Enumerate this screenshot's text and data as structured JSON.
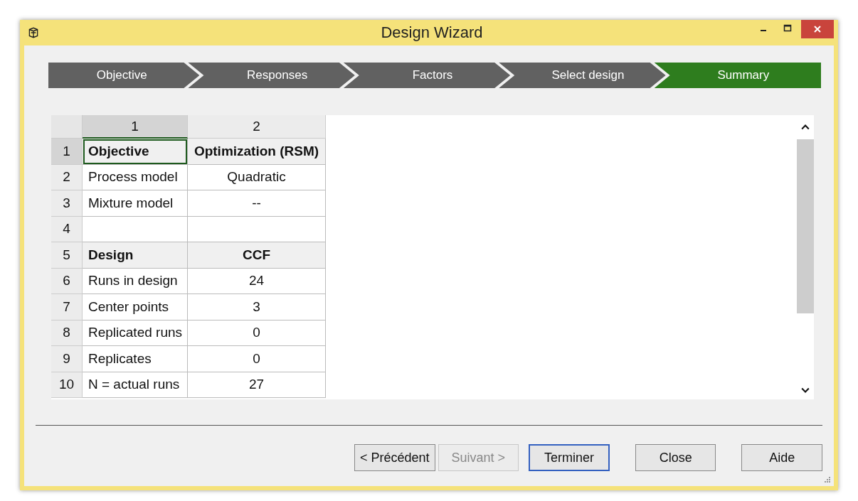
{
  "window": {
    "title": "Design Wizard"
  },
  "steps": [
    {
      "label": "Objective",
      "selected": false
    },
    {
      "label": "Responses",
      "selected": false
    },
    {
      "label": "Factors",
      "selected": false
    },
    {
      "label": "Select design",
      "selected": false
    },
    {
      "label": "Summary",
      "selected": true
    }
  ],
  "table": {
    "columns": [
      {
        "label": "1",
        "selected": true
      },
      {
        "label": "2",
        "selected": false
      }
    ],
    "rows": [
      {
        "number": "1",
        "kind": "heading",
        "cells": [
          {
            "text": "Objective",
            "selected": true
          },
          {
            "text": "Optimization (RSM)",
            "selected": false
          }
        ]
      },
      {
        "number": "2",
        "kind": "plain",
        "cells": [
          {
            "text": "Process model",
            "selected": false
          },
          {
            "text": "Quadratic",
            "selected": false
          }
        ]
      },
      {
        "number": "3",
        "kind": "plain",
        "cells": [
          {
            "text": "Mixture model",
            "selected": false
          },
          {
            "text": "--",
            "selected": false
          }
        ]
      },
      {
        "number": "4",
        "kind": "plain",
        "cells": [
          {
            "selected": false
          },
          {
            "selected": false
          }
        ]
      },
      {
        "number": "5",
        "kind": "heading",
        "cells": [
          {
            "text": "Design",
            "selected": false
          },
          {
            "text": "CCF",
            "selected": false
          }
        ]
      },
      {
        "number": "6",
        "kind": "plain",
        "cells": [
          {
            "text": "Runs in design",
            "selected": false
          },
          {
            "text": "24",
            "selected": false
          }
        ]
      },
      {
        "number": "7",
        "kind": "plain",
        "cells": [
          {
            "text": "Center points",
            "selected": false
          },
          {
            "text": "3",
            "selected": false
          }
        ]
      },
      {
        "number": "8",
        "kind": "plain",
        "cells": [
          {
            "text": "Replicated runs",
            "selected": false
          },
          {
            "text": "0",
            "selected": false
          }
        ]
      },
      {
        "number": "9",
        "kind": "plain",
        "cells": [
          {
            "text": "Replicates",
            "selected": false
          },
          {
            "text": "0",
            "selected": false
          }
        ]
      },
      {
        "number": "10",
        "kind": "plain",
        "cells": [
          {
            "text": "N = actual runs",
            "selected": false
          },
          {
            "text": "27",
            "selected": false
          }
        ]
      }
    ]
  },
  "buttons": [
    {
      "label": "< Précédent",
      "disabled": false,
      "default": false
    },
    {
      "label": "Suivant >",
      "disabled": true,
      "default": false
    },
    {
      "label": "Terminer",
      "disabled": false,
      "default": true
    },
    {
      "label": "Close",
      "disabled": false,
      "default": false
    },
    {
      "label": "Aide",
      "disabled": false,
      "default": false
    }
  ]
}
